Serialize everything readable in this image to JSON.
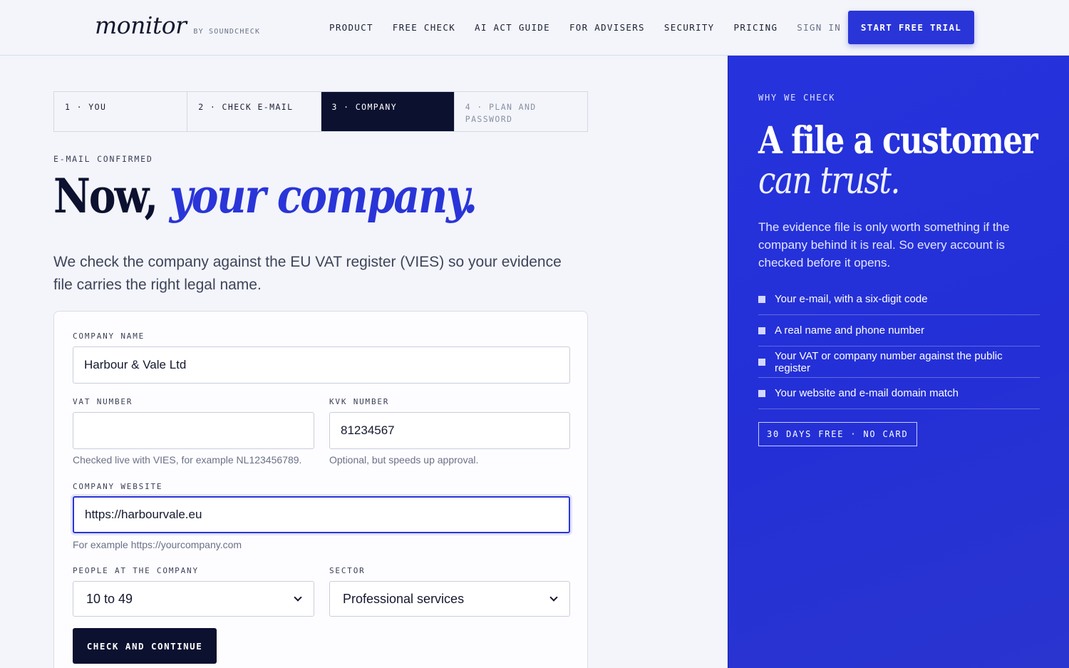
{
  "header": {
    "logo_word": "monitor",
    "logo_by": "BY SOUNDCHECK",
    "nav": [
      {
        "label": "PRODUCT"
      },
      {
        "label": "FREE CHECK"
      },
      {
        "label": "AI ACT GUIDE"
      },
      {
        "label": "FOR ADVISERS"
      },
      {
        "label": "SECURITY"
      },
      {
        "label": "PRICING"
      },
      {
        "label": "SIGN IN"
      }
    ],
    "cta_label": "START FREE TRIAL"
  },
  "steps": [
    {
      "label": "1 · YOU"
    },
    {
      "label": "2 · CHECK E-MAIL"
    },
    {
      "label": "3 · COMPANY",
      "active": true
    },
    {
      "label": "4 · PLAN AND PASSWORD"
    }
  ],
  "main": {
    "eyebrow": "E-MAIL CONFIRMED",
    "headline_plain": "Now,",
    "headline_em": "your company.",
    "lede": "We check the company against the EU VAT register (VIES) so your evidence file carries the right legal name."
  },
  "form": {
    "company_name": {
      "label": "COMPANY NAME",
      "value": "Harbour & Vale Ltd"
    },
    "vat": {
      "label": "VAT NUMBER",
      "value": "",
      "hint": "Checked live with VIES, for example NL123456789."
    },
    "kvk": {
      "label": "KVK NUMBER",
      "value": "81234567",
      "hint": "Optional, but speeds up approval."
    },
    "website": {
      "label": "COMPANY WEBSITE",
      "value": "https://harbourvale.eu",
      "hint": "For example https://yourcompany.com"
    },
    "people": {
      "label": "PEOPLE AT THE COMPANY",
      "selected": "10 to 49"
    },
    "sector": {
      "label": "SECTOR",
      "selected": "Professional services"
    },
    "submit_label": "CHECK AND CONTINUE"
  },
  "side": {
    "eyebrow": "WHY WE CHECK",
    "title_line1": "A file a customer",
    "title_line2": "can trust.",
    "copy": "The evidence file is only worth something if the company behind it is real. So every account is checked before it opens.",
    "checklist": [
      "Your e-mail, with a six-digit code",
      "A real name and phone number",
      "Your VAT or company number against the public register",
      "Your website and e-mail domain match"
    ],
    "pill": "30 DAYS FREE · NO CARD"
  },
  "colors": {
    "accent": "#2a35d8",
    "ink": "#0c1130",
    "background": "#f3f5fa"
  }
}
